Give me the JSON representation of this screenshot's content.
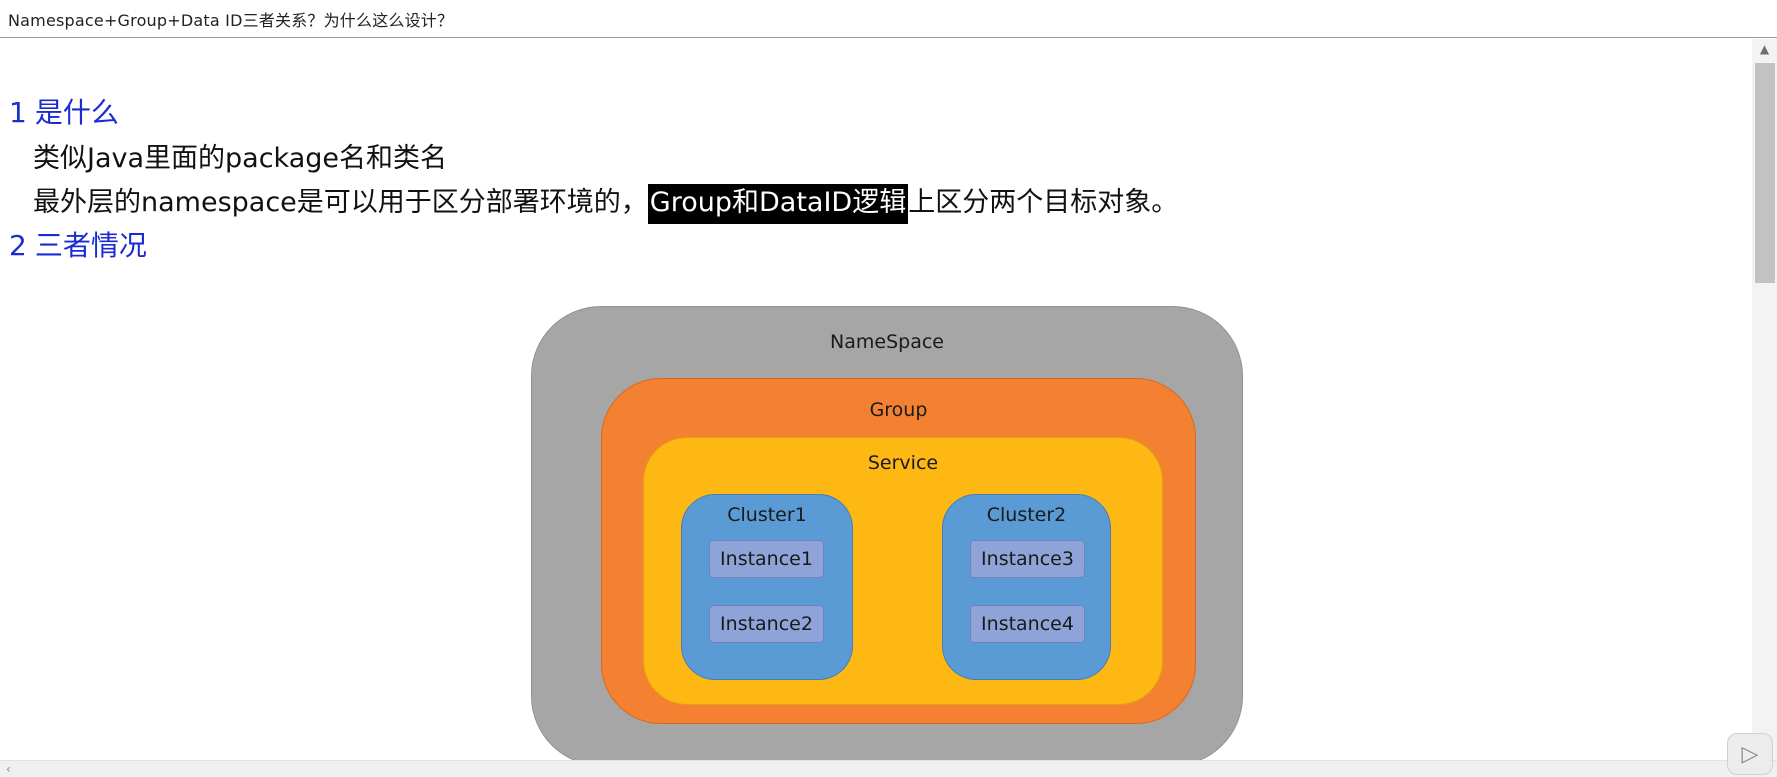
{
  "window": {
    "title": "Namespace+Group+Data ID三者关系？为什么这么设计？"
  },
  "document": {
    "section1": {
      "num": "1",
      "title": "是什么"
    },
    "line1": "类似Java里面的package名和类名",
    "line2": {
      "before": "最外层的namespace是可以用于区分部署环境的，",
      "highlighted": "Group和DataID逻辑",
      "after": "上区分两个目标对象。"
    },
    "section2": {
      "num": "2",
      "title": "三者情况"
    }
  },
  "diagram": {
    "namespace": "NameSpace",
    "group": "Group",
    "service": "Service",
    "clusters": [
      {
        "name": "Cluster1",
        "instances": [
          "Instance1",
          "Instance2"
        ]
      },
      {
        "name": "Cluster2",
        "instances": [
          "Instance3",
          "Instance4"
        ]
      }
    ],
    "colors": {
      "namespace": "#a6a6a6",
      "group": "#f48131",
      "service": "#fdb813",
      "cluster": "#5b9bd5",
      "instance": "#8ea3d8"
    }
  },
  "icons": {
    "scroll_up": "chevron-up-icon",
    "scroll_left": "chevron-left-icon",
    "play": "play-icon"
  }
}
